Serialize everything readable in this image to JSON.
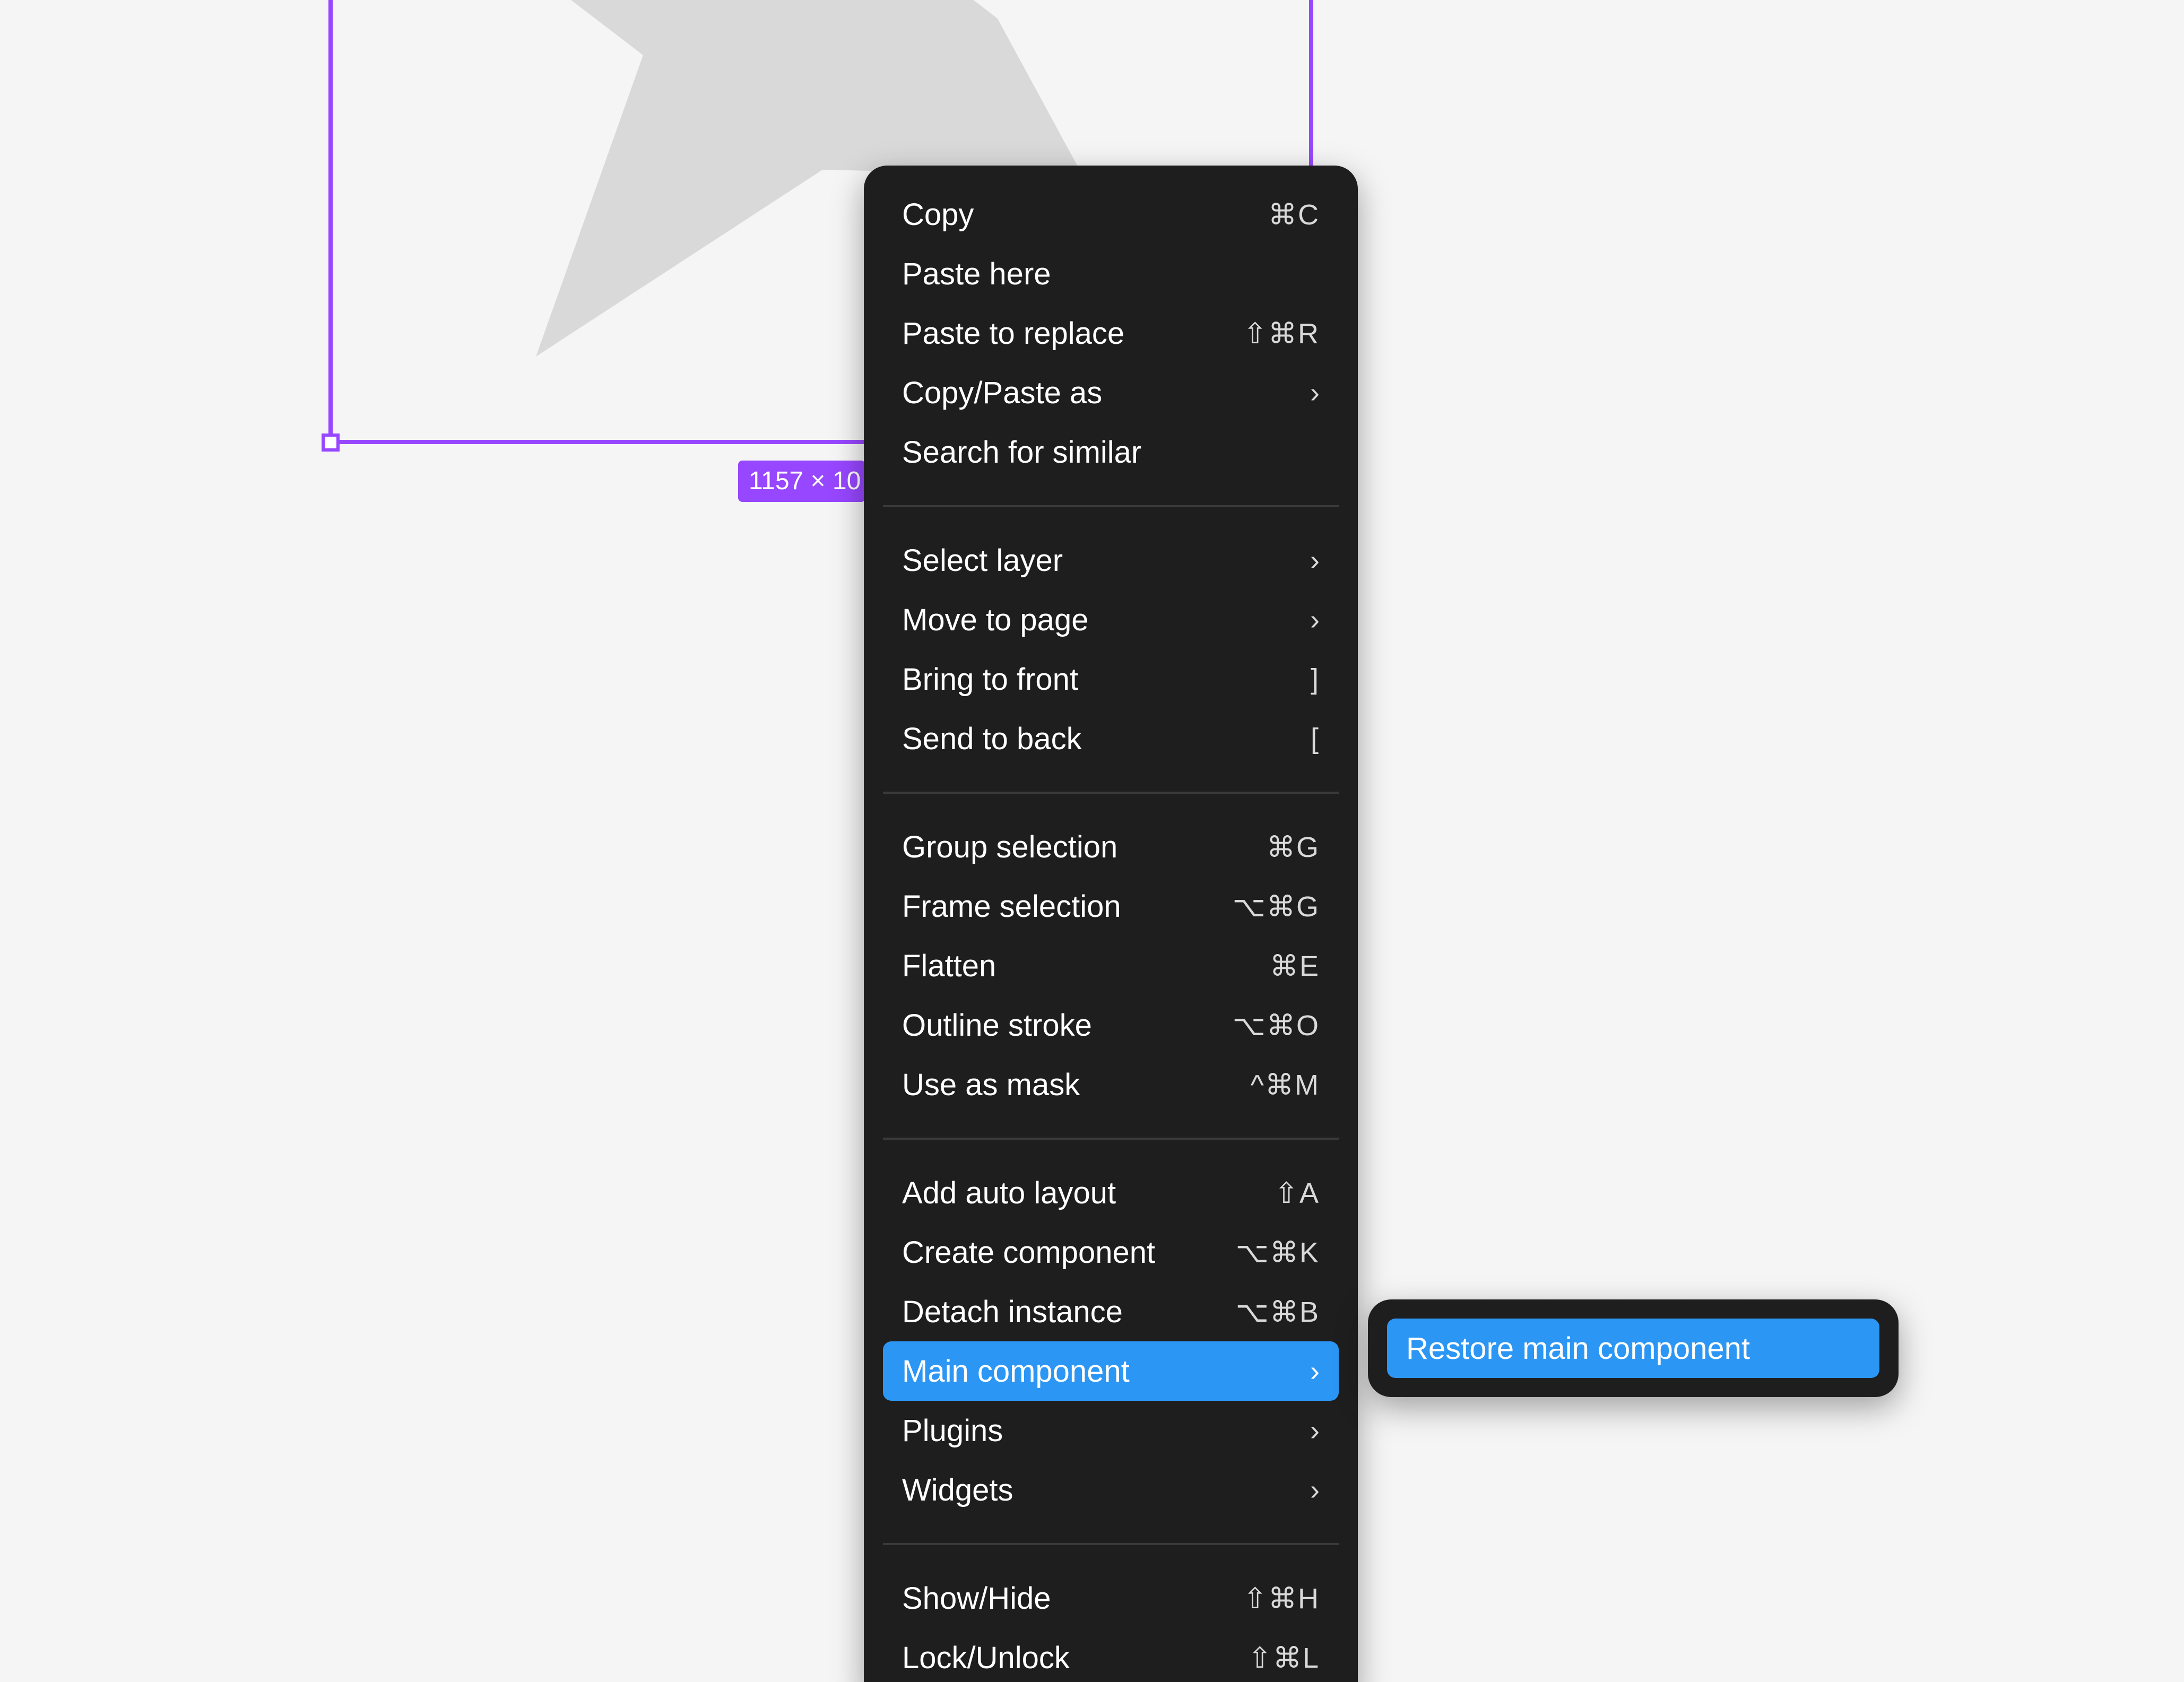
{
  "canvas": {
    "background": "#f5f5f5",
    "selection_color": "#9747ff",
    "dimension_label": "1157 × 10"
  },
  "context_menu": {
    "background": "#1e1e1e",
    "highlight_color": "#2c96f5",
    "groups": [
      [
        {
          "label": "Copy",
          "shortcut": "⌘C",
          "submenu": false
        },
        {
          "label": "Paste here",
          "shortcut": "",
          "submenu": false
        },
        {
          "label": "Paste to replace",
          "shortcut": "⇧⌘R",
          "submenu": false
        },
        {
          "label": "Copy/Paste as",
          "shortcut": "",
          "submenu": true
        },
        {
          "label": "Search for similar",
          "shortcut": "",
          "submenu": false
        }
      ],
      [
        {
          "label": "Select layer",
          "shortcut": "",
          "submenu": true
        },
        {
          "label": "Move to page",
          "shortcut": "",
          "submenu": true
        },
        {
          "label": "Bring to front",
          "shortcut": "]",
          "submenu": false
        },
        {
          "label": "Send to back",
          "shortcut": "[",
          "submenu": false
        }
      ],
      [
        {
          "label": "Group selection",
          "shortcut": "⌘G",
          "submenu": false
        },
        {
          "label": "Frame selection",
          "shortcut": "⌥⌘G",
          "submenu": false
        },
        {
          "label": "Flatten",
          "shortcut": "⌘E",
          "submenu": false
        },
        {
          "label": "Outline stroke",
          "shortcut": "⌥⌘O",
          "submenu": false
        },
        {
          "label": "Use as mask",
          "shortcut": "^⌘M",
          "submenu": false
        }
      ],
      [
        {
          "label": "Add auto layout",
          "shortcut": "⇧A",
          "submenu": false
        },
        {
          "label": "Create component",
          "shortcut": "⌥⌘K",
          "submenu": false
        },
        {
          "label": "Detach instance",
          "shortcut": "⌥⌘B",
          "submenu": false
        },
        {
          "label": "Main component",
          "shortcut": "",
          "submenu": true,
          "active": true
        },
        {
          "label": "Plugins",
          "shortcut": "",
          "submenu": true
        },
        {
          "label": "Widgets",
          "shortcut": "",
          "submenu": true
        }
      ],
      [
        {
          "label": "Show/Hide",
          "shortcut": "⇧⌘H",
          "submenu": false
        },
        {
          "label": "Lock/Unlock",
          "shortcut": "⇧⌘L",
          "submenu": false
        }
      ]
    ]
  },
  "submenu": {
    "items": [
      {
        "label": "Restore main component",
        "active": true
      }
    ]
  },
  "icons": {
    "chevron": "chevron-right-icon",
    "star": "star-shape"
  }
}
